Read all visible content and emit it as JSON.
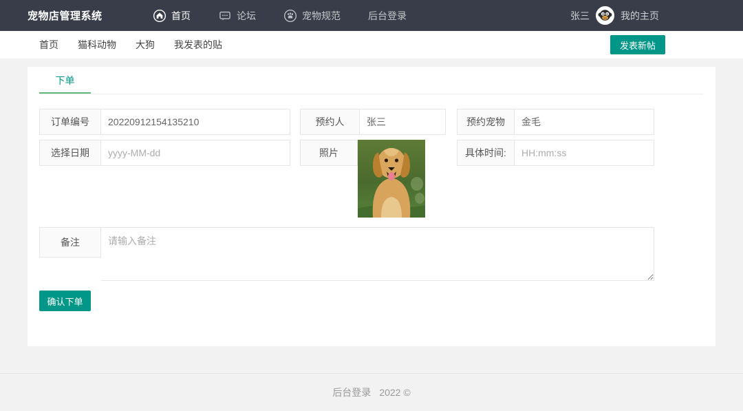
{
  "topnav": {
    "brand": "宠物店管理系统",
    "items": [
      {
        "label": "首页",
        "icon": "home-icon"
      },
      {
        "label": "论坛",
        "icon": "chat-icon"
      },
      {
        "label": "宠物规范",
        "icon": "paw-icon"
      },
      {
        "label": "后台登录",
        "icon": null
      }
    ],
    "username": "张三",
    "my_home_label": "我的主页"
  },
  "subnav": {
    "items": [
      "首页",
      "猫科动物",
      "大狗",
      "我发表的贴"
    ],
    "new_post_button": "发表新帖"
  },
  "order_form": {
    "tab_label": "下单",
    "fields": {
      "order_no": {
        "label": "订单编号",
        "value": "20220912154135210"
      },
      "reserver": {
        "label": "预约人",
        "value": "张三"
      },
      "pet": {
        "label": "预约宠物",
        "value": "金毛"
      },
      "date": {
        "label": "选择日期",
        "placeholder": "yyyy-MM-dd"
      },
      "photo": {
        "label": "照片",
        "image": "golden-retriever-photo"
      },
      "time": {
        "label": "具体时间:",
        "placeholder": "HH:mm:ss"
      },
      "remark": {
        "label": "备注",
        "placeholder": "请输入备注"
      }
    },
    "submit_button": "确认下单"
  },
  "footer": {
    "link": "后台登录",
    "copyright": "2022 ©"
  },
  "colors": {
    "navbar_bg": "#393D49",
    "accent_teal": "#009688",
    "tab_underline": "#5FB878",
    "page_bg": "#f2f2f2"
  }
}
